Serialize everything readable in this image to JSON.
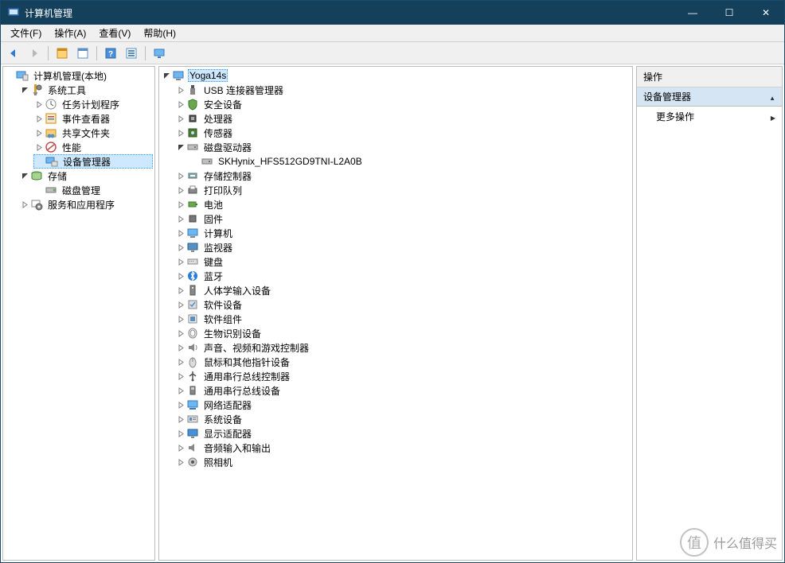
{
  "window": {
    "title": "计算机管理",
    "controls": {
      "minimize": "—",
      "maximize": "☐",
      "close": "✕"
    }
  },
  "menubar": {
    "file": "文件(F)",
    "action": "操作(A)",
    "view": "查看(V)",
    "help": "帮助(H)"
  },
  "leftTree": {
    "root": "计算机管理(本地)",
    "systemTools": "系统工具",
    "taskScheduler": "任务计划程序",
    "eventViewer": "事件查看器",
    "sharedFolders": "共享文件夹",
    "performance": "性能",
    "deviceManager": "设备管理器",
    "storage": "存储",
    "diskManagement": "磁盘管理",
    "servicesApps": "服务和应用程序"
  },
  "centerTree": {
    "root": "Yoga14s",
    "usb": "USB 连接器管理器",
    "securityDevices": "安全设备",
    "processors": "处理器",
    "sensors": "传感器",
    "diskDrives": "磁盘驱动器",
    "disk0": "SKHynix_HFS512GD9TNI-L2A0B",
    "storageControllers": "存储控制器",
    "printQueues": "打印队列",
    "batteries": "电池",
    "firmware": "固件",
    "computer": "计算机",
    "monitors": "监视器",
    "keyboards": "键盘",
    "bluetooth": "蓝牙",
    "hid": "人体学输入设备",
    "softwareDevices": "软件设备",
    "softwareComponents": "软件组件",
    "biometric": "生物识别设备",
    "audioVideoGame": "声音、视频和游戏控制器",
    "mice": "鼠标和其他指针设备",
    "usbControllers": "通用串行总线控制器",
    "usbDevices": "通用串行总线设备",
    "networkAdapters": "网络适配器",
    "systemDevices": "系统设备",
    "displayAdapters": "显示适配器",
    "audioIO": "音频输入和输出",
    "cameras": "照相机"
  },
  "rightPane": {
    "header": "操作",
    "groupTitle": "设备管理器",
    "moreActions": "更多操作"
  },
  "watermark": {
    "badge": "值",
    "text": "什么值得买"
  }
}
